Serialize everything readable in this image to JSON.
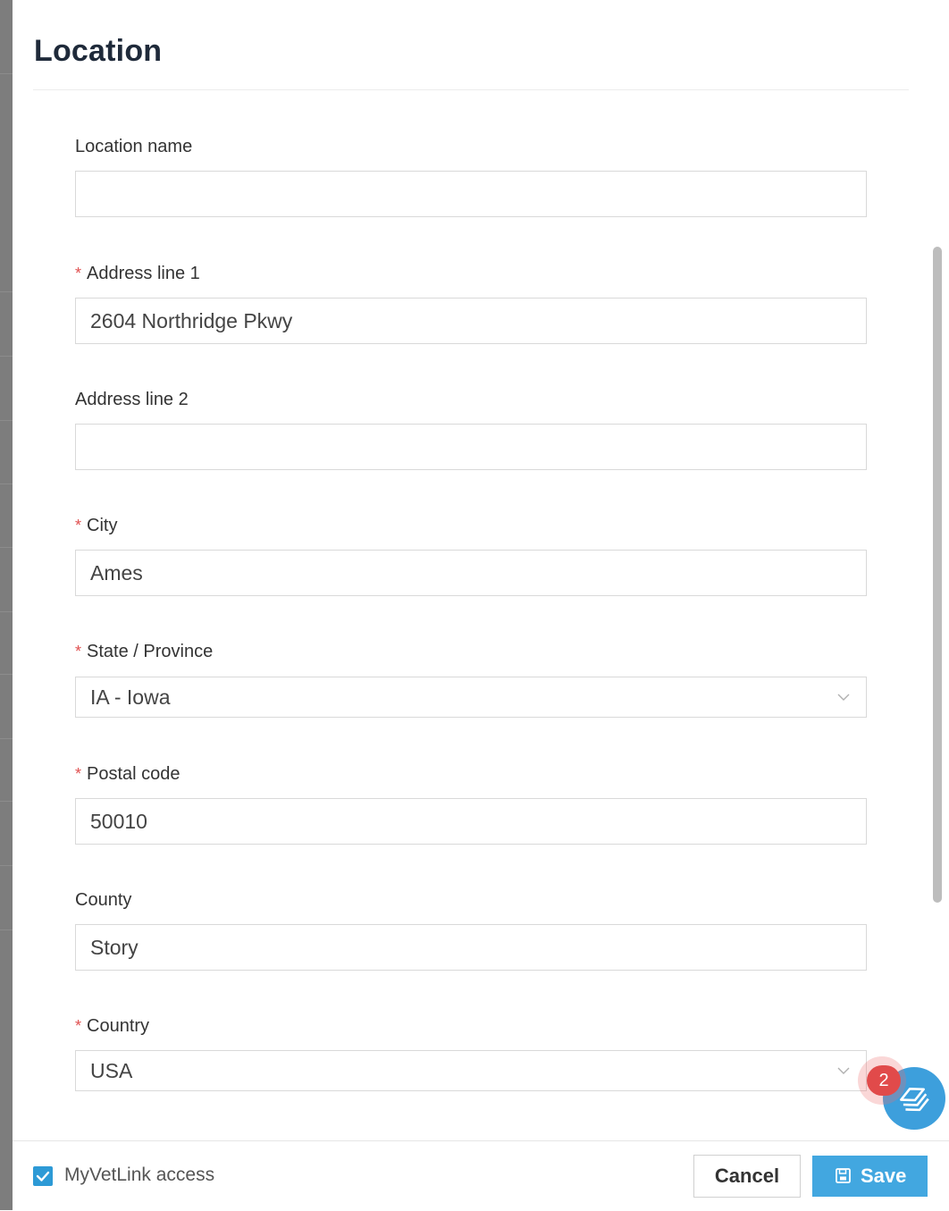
{
  "dialog": {
    "title": "Location"
  },
  "form": {
    "location_name": {
      "label": "Location name",
      "value": "",
      "required": false
    },
    "address_line_1": {
      "label": "Address line 1",
      "value": "2604 Northridge Pkwy",
      "required": true
    },
    "address_line_2": {
      "label": "Address line 2",
      "value": "",
      "required": false
    },
    "city": {
      "label": "City",
      "value": "Ames",
      "required": true
    },
    "state_province": {
      "label": "State / Province",
      "value": "IA - Iowa",
      "required": true
    },
    "postal_code": {
      "label": "Postal code",
      "value": "50010",
      "required": true
    },
    "county": {
      "label": "County",
      "value": "Story",
      "required": false
    },
    "country": {
      "label": "Country",
      "value": "USA",
      "required": true
    },
    "required_marker": "*"
  },
  "footer": {
    "myvetlink_access": {
      "label": "MyVetLink access",
      "checked": true
    },
    "cancel_label": "Cancel",
    "save_label": "Save"
  },
  "help_widget": {
    "badge_count": "2",
    "icon": "layers-icon"
  },
  "colors": {
    "accent": "#42a7e0",
    "required": "#e05050",
    "badge": "#e14a4a",
    "title": "#1f2a3a"
  }
}
